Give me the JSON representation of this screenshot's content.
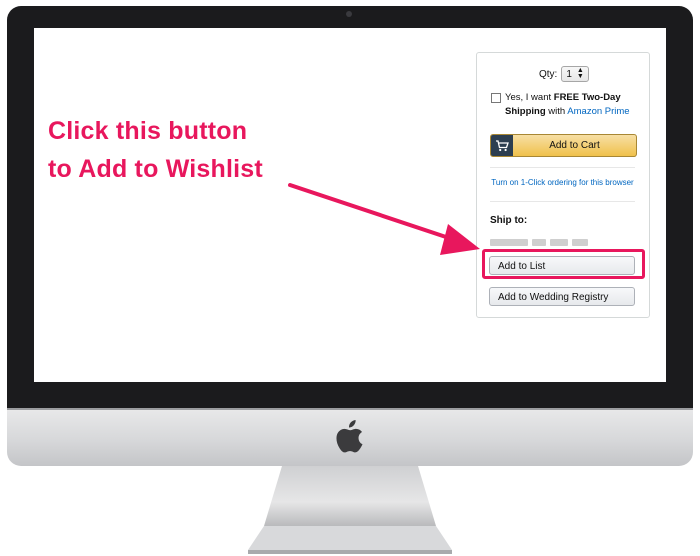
{
  "buy_box": {
    "qty_label": "Qty:",
    "qty_value": "1",
    "prime_offer_prefix": "Yes, I want ",
    "prime_offer_bold": "FREE Two-Day Shipping",
    "prime_offer_with": " with ",
    "prime_link": "Amazon Prime",
    "add_to_cart_label": "Add to Cart",
    "one_click_link": "Turn on 1-Click ordering for this browser",
    "ship_to_label": "Ship to:",
    "add_to_list_label": "Add to List",
    "add_to_wedding_registry_label": "Add to Wedding Registry"
  },
  "annotation": {
    "line1": "Click this button",
    "line2": "to Add to Wishlist",
    "color": "#e8175d"
  },
  "colors": {
    "cart_button": "#f0c14b",
    "link": "#0066c0",
    "bezel": "#1b1b1d"
  }
}
